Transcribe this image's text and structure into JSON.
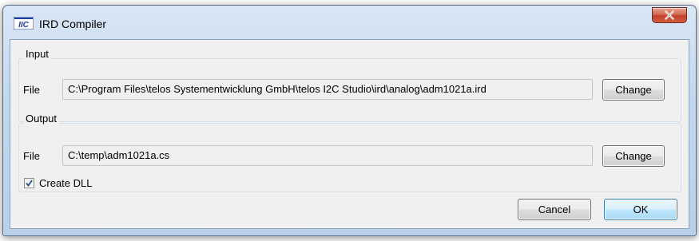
{
  "window": {
    "title": "IRD Compiler",
    "app_icon_text": "IIC",
    "close_glyph": "close-icon"
  },
  "input": {
    "group_label": "Input",
    "file_label": "File",
    "path": "C:\\Program Files\\telos Systementwicklung GmbH\\telos I2C Studio\\ird\\analog\\adm1021a.ird",
    "change_label": "Change"
  },
  "output": {
    "group_label": "Output",
    "file_label": "File",
    "path": "C:\\temp\\adm1021a.cs",
    "change_label": "Change",
    "create_dll_label": "Create DLL",
    "create_dll_checked": true
  },
  "footer": {
    "cancel_label": "Cancel",
    "ok_label": "OK"
  },
  "colors": {
    "accent": "#3c7fb1",
    "close_button": "#c2402a",
    "icon_blue": "#1d3f9e"
  }
}
